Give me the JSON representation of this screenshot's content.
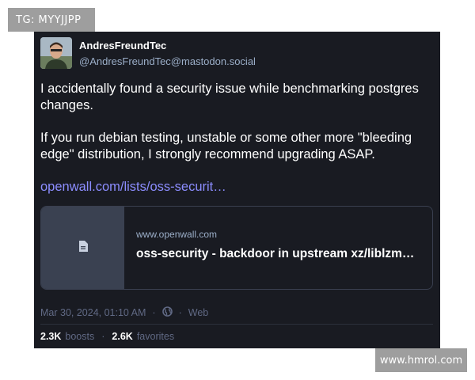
{
  "watermarks": {
    "top_left": "TG: MYYJJPP",
    "bottom_right": "www.hmrol.com"
  },
  "post": {
    "author": {
      "display_name": "AndresFreundTec",
      "handle": "@AndresFreundTec@mastodon.social"
    },
    "paragraphs": [
      "I accidentally found a security issue while benchmarking postgres changes.",
      "If you run debian testing, unstable or some other more \"bleeding edge\" distribution, I strongly recommend upgrading ASAP."
    ],
    "link_text": "openwall.com/lists/oss-securit…",
    "preview": {
      "domain": "www.openwall.com",
      "title": "oss-security - backdoor in upstream xz/liblzm…",
      "icon": "document-icon"
    },
    "meta": {
      "timestamp": "Mar 30, 2024, 01:10 AM",
      "separator": "·",
      "visibility_icon": "globe-icon",
      "client": "Web"
    },
    "stats": {
      "boosts_count": "2.3K",
      "boosts_label": "boosts",
      "favorites_count": "2.6K",
      "favorites_label": "favorites",
      "separator": "·"
    }
  },
  "colors": {
    "card_bg": "#191b22",
    "link": "#8c8dff",
    "muted": "#606984",
    "handle": "#9baec8"
  }
}
